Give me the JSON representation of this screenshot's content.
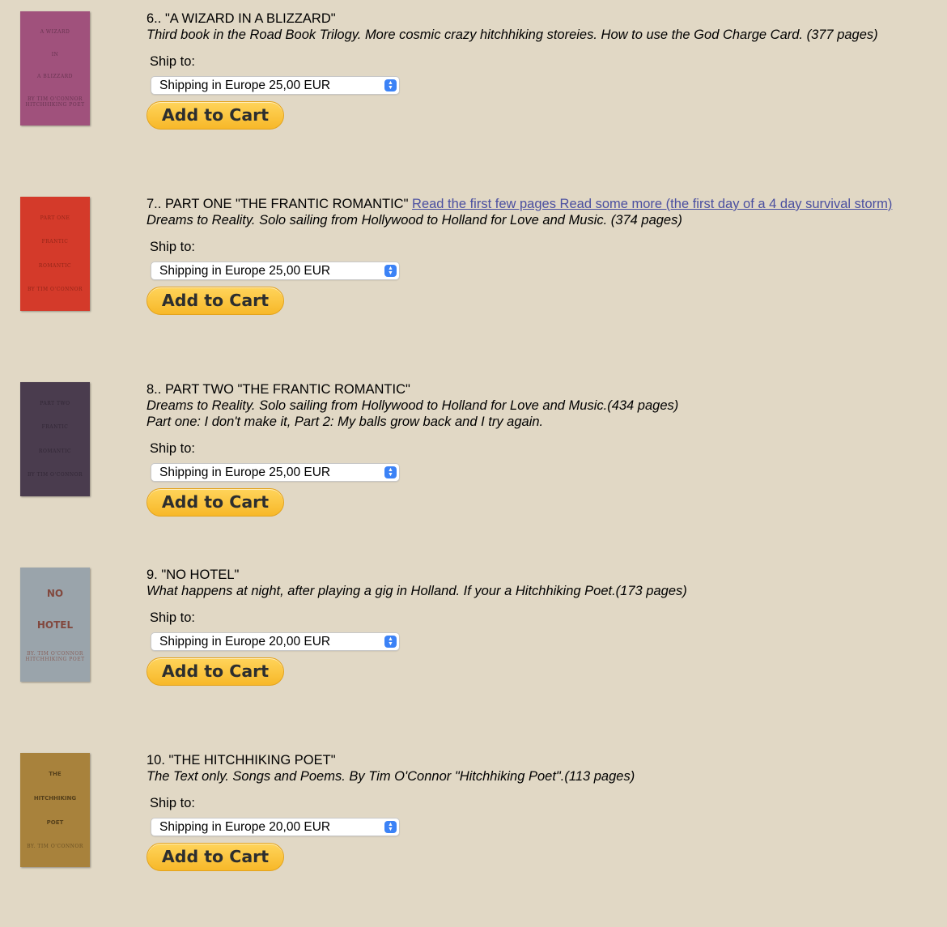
{
  "books": [
    {
      "number": "6..",
      "title": "\"A WIZARD IN A BLIZZARD\"",
      "links": [],
      "description": [
        "Third book in the Road Book Trilogy. More cosmic crazy hitchhiking storeies. How to use the God Charge Card. (377 pages)"
      ],
      "ship_label": "Ship to:",
      "shipping": "Shipping in Europe 25,00 EUR",
      "cart_label": "Add to Cart",
      "cover": {
        "color": "#a0517c",
        "text_color": "#3a1a2c",
        "lines": [
          "A WIZARD",
          "IN",
          "A BLIZZARD",
          "BY TIM O'CONNOR HITCHHIKING POET"
        ]
      }
    },
    {
      "number": "7..",
      "title": "PART ONE \"THE FRANTIC ROMANTIC\"",
      "links": [
        "Read the first few pages ",
        "Read some more (the first day of a 4 day survival storm)"
      ],
      "description": [
        "Dreams to Reality. Solo sailing from Hollywood to Holland for Love and Music. (374 pages)"
      ],
      "ship_label": "Ship to:",
      "shipping": "Shipping in Europe 25,00 EUR",
      "cart_label": "Add to Cart",
      "cover": {
        "color": "#d43a2a",
        "text_color": "#5a1208",
        "lines": [
          "PART ONE",
          "FRANTIC",
          "ROMANTIC",
          "BY TIM O'CONNOR"
        ]
      }
    },
    {
      "number": "8..",
      "title": "PART TWO \"THE FRANTIC ROMANTIC\"",
      "links": [],
      "description": [
        "Dreams to Reality. Solo sailing from Hollywood to Holland for Love and Music.(434 pages)",
        "Part one: I don't make it, Part 2: My balls grow back and I try again."
      ],
      "ship_label": "Ship to:",
      "shipping": "Shipping in Europe 25,00 EUR",
      "cart_label": "Add to Cart",
      "cover": {
        "color": "#4a3c4e",
        "text_color": "#1c1420",
        "lines": [
          "PART TWO",
          "FRANTIC",
          "ROMANTIC",
          "BY TIM O'CONNOR"
        ]
      }
    },
    {
      "number": "9.",
      "title": "\"NO HOTEL\"",
      "links": [],
      "description": [
        "What happens at night, after playing a gig in Holland. If your a Hitchhiking Poet.(173 pages)"
      ],
      "ship_label": "Ship to:",
      "shipping": "Shipping in Europe 20,00 EUR",
      "cart_label": "Add to Cart",
      "cover": {
        "color": "#9aa4ab",
        "text_color": "#7a2a1a",
        "bold": true,
        "lines": [
          "NO",
          "HOTEL",
          "BY. TIM O'CONNOR HITCHHIKING POET"
        ]
      }
    },
    {
      "number": "10.",
      "title": "\"THE HITCHHIKING POET\"",
      "links": [],
      "description": [
        "The Text only. Songs and Poems. By Tim O'Connor \"Hitchhiking Poet\".(113 pages)"
      ],
      "ship_label": "Ship to:",
      "shipping": "Shipping in Europe 20,00 EUR",
      "cart_label": "Add to Cart",
      "cover": {
        "color": "#a8823c",
        "text_color": "#3a2a10",
        "bold": true,
        "small": true,
        "lines": [
          "THE",
          "HITCHHIKING",
          "POET",
          "BY. TIM O'CONNOR"
        ]
      }
    }
  ]
}
